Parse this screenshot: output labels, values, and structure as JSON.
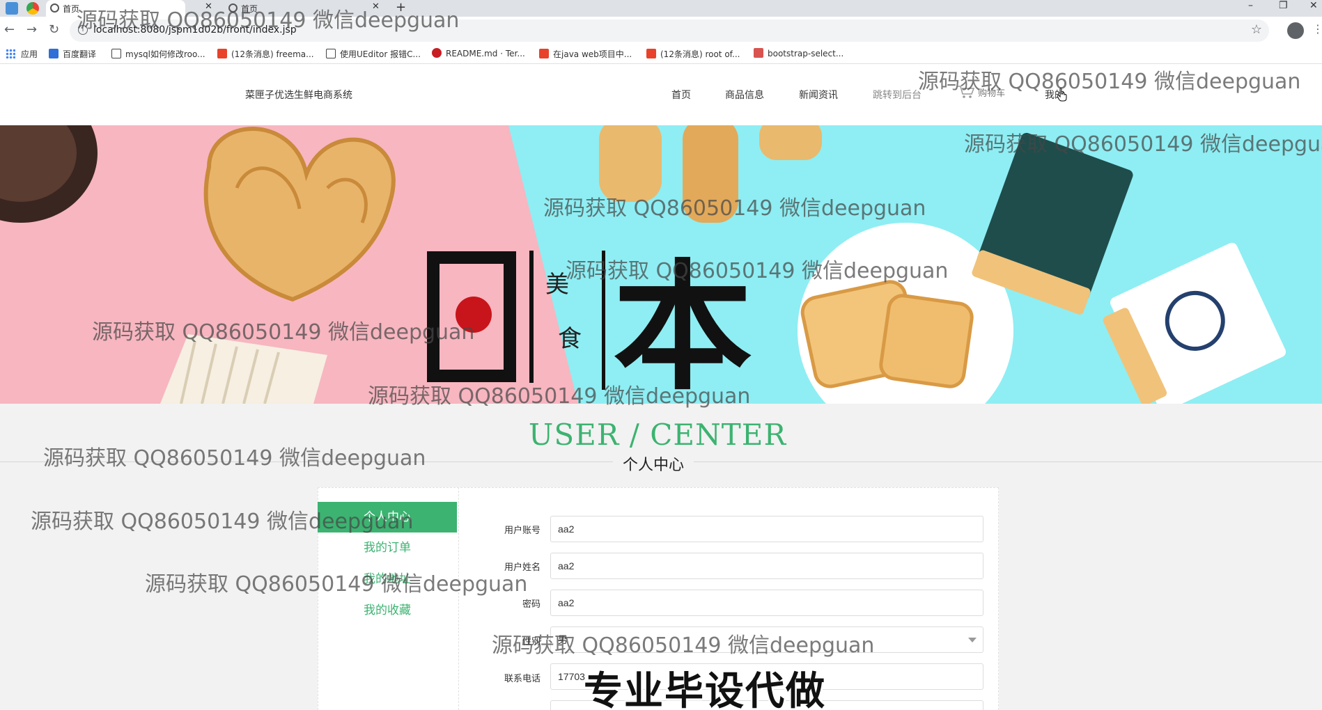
{
  "browser": {
    "tabs": [
      {
        "title": "首页",
        "icon": "globe-icon"
      },
      {
        "title": "首页",
        "icon": "globe-icon"
      }
    ],
    "url": "localhost:8080/jspm1d02b/front/index.jsp",
    "bookmarks": [
      {
        "label": "应用",
        "icon": "apps-grid-icon",
        "color": "#4285f4"
      },
      {
        "label": "百度翻译",
        "icon": "baidu-translate-icon",
        "color": "#2f6fd6"
      },
      {
        "label": "mysql如何修改roo...",
        "icon": "bookmark-icon",
        "color": "#444444"
      },
      {
        "label": "(12条消息) freema...",
        "icon": "csdn-icon",
        "color": "#e8422b"
      },
      {
        "label": "使用UEditor 报错C...",
        "icon": "bookmark-icon",
        "color": "#444444"
      },
      {
        "label": "README.md · Ter...",
        "icon": "gitee-icon",
        "color": "#c71d23"
      },
      {
        "label": "在java web项目中...",
        "icon": "csdn-icon",
        "color": "#e8422b"
      },
      {
        "label": "(12条消息) root of...",
        "icon": "csdn-icon",
        "color": "#e8422b"
      },
      {
        "label": "bootstrap-select...",
        "icon": "bookmark-icon",
        "color": "#d9534f"
      }
    ]
  },
  "site": {
    "brand": "菜匣子优选生鲜电商系统",
    "nav": [
      {
        "label": "首页"
      },
      {
        "label": "商品信息"
      },
      {
        "label": "新闻资讯"
      },
      {
        "label": "跳转到后台"
      },
      {
        "label": "我的"
      }
    ],
    "cart_label": "购物车"
  },
  "banner": {
    "big_chars": [
      "日",
      "本"
    ],
    "small_chars": [
      "美",
      "食"
    ],
    "colors": {
      "pink": "#f7b6c0",
      "cyan": "#8eeef3",
      "red_dot": "#c8151b",
      "ink": "#111111"
    }
  },
  "heading": {
    "en": "USER / CENTER",
    "cn": "个人中心"
  },
  "sidebar": {
    "items": [
      {
        "label": "个人中心",
        "active": true
      },
      {
        "label": "我的订单",
        "active": false
      },
      {
        "label": "我的地址",
        "active": false
      },
      {
        "label": "我的收藏",
        "active": false
      }
    ]
  },
  "form": {
    "fields": [
      {
        "label": "用户账号",
        "value": "aa2"
      },
      {
        "label": "用户姓名",
        "value": "aa2"
      },
      {
        "label": "密码",
        "value": "aa2"
      },
      {
        "label": "性别",
        "value": "男"
      },
      {
        "label": "联系电话",
        "value": "17703"
      }
    ]
  },
  "overlays": {
    "watermark": "源码获取 QQ86050149 微信deepguan",
    "ad_text": "专业毕设代做"
  },
  "colors": {
    "accent": "#3cb371",
    "page_bg": "#f2f2f2"
  }
}
